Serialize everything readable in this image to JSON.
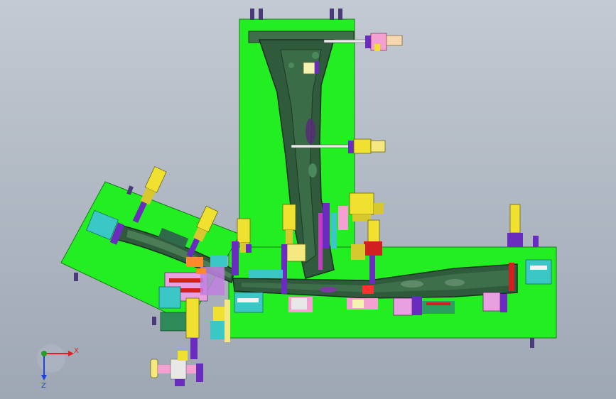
{
  "window": {
    "view": "cad-3d-viewport"
  },
  "colors": {
    "background_top": "#c4cad3",
    "background_bottom": "#9ea7b4",
    "base_plate": "#22ee22",
    "part_dark": "#2f5a3c",
    "clamp_yellow": "#f0e030",
    "clamp_purple": "#6a2bbf",
    "clamp_pink": "#f4a0d0",
    "clamp_cyan": "#3cc7c7",
    "clamp_orange": "#ff8a2a",
    "clamp_red": "#d02020",
    "axis_x": "#e02020",
    "axis_y": "#20a020",
    "axis_z": "#2040e0"
  },
  "triad": {
    "x_label": "X",
    "z_label": "Z"
  }
}
